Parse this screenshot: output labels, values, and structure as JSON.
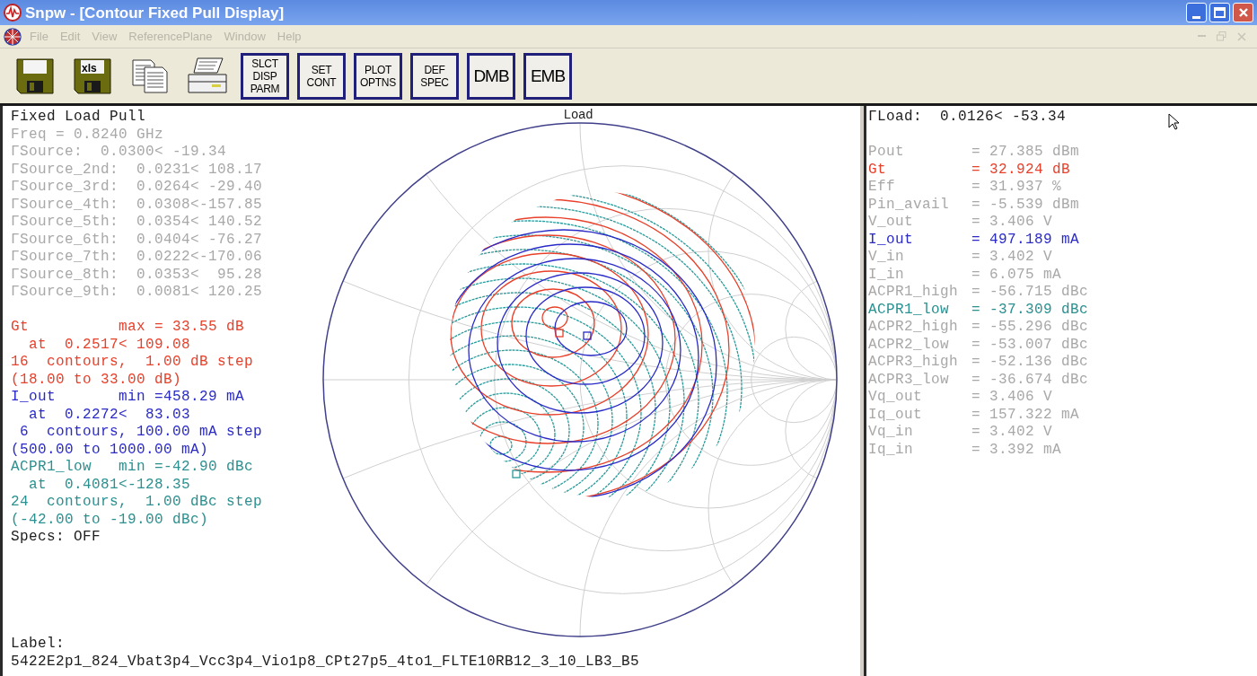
{
  "window": {
    "title": "Snpw - [Contour Fixed Pull Display]"
  },
  "menu": [
    {
      "label": "File",
      "disabled": true
    },
    {
      "label": "Edit",
      "disabled": true
    },
    {
      "label": "View",
      "disabled": true
    },
    {
      "label": "ReferencePlane",
      "disabled": true
    },
    {
      "label": "Window",
      "disabled": true
    },
    {
      "label": "Help",
      "disabled": true
    }
  ],
  "toolbar": [
    {
      "kind": "floppy"
    },
    {
      "kind": "floppy",
      "text": "xls"
    },
    {
      "kind": "copy"
    },
    {
      "kind": "printer"
    },
    {
      "kind": "text",
      "label": "SLCT\nDISP\nPARM"
    },
    {
      "kind": "text",
      "label": "SET\nCONT"
    },
    {
      "kind": "text",
      "label": "PLOT\nOPTNS"
    },
    {
      "kind": "text",
      "label": "DEF\nSPEC"
    },
    {
      "kind": "big",
      "label": "DMB"
    },
    {
      "kind": "big",
      "label": "EMB"
    }
  ],
  "left_panel": {
    "heading": "Fixed Load Pull",
    "source_lines": [
      {
        "text": "Freq = 0.8240 GHz",
        "color": "#a8a8a8"
      },
      {
        "text": "ΓSource:  0.0300< -19.34",
        "color": "#a8a8a8"
      },
      {
        "text": "ΓSource_2nd:  0.0231< 108.17",
        "color": "#a8a8a8"
      },
      {
        "text": "ΓSource_3rd:  0.0264< -29.40",
        "color": "#a8a8a8"
      },
      {
        "text": "ΓSource_4th:  0.0308<-157.85",
        "color": "#a8a8a8"
      },
      {
        "text": "ΓSource_5th:  0.0354< 140.52",
        "color": "#a8a8a8"
      },
      {
        "text": "ΓSource_6th:  0.0404< -76.27",
        "color": "#a8a8a8"
      },
      {
        "text": "ΓSource_7th:  0.0222<-170.06",
        "color": "#a8a8a8"
      },
      {
        "text": "ΓSource_8th:  0.0353<  95.28",
        "color": "#a8a8a8"
      },
      {
        "text": "ΓSource_9th:  0.0081< 120.25",
        "color": "#a8a8a8"
      }
    ],
    "contour_lines": [
      {
        "text": "Gt          max = 33.55 dB",
        "color": "#e8402a"
      },
      {
        "text": "  at  0.2517< 109.08",
        "color": "#e8402a"
      },
      {
        "text": "16  contours,  1.00 dB step",
        "color": "#e8402a"
      },
      {
        "text": "(18.00 to 33.00 dB)",
        "color": "#e8402a"
      },
      {
        "text": "I_out       min =458.29 mA",
        "color": "#2a2ac8"
      },
      {
        "text": "  at  0.2272<  83.03",
        "color": "#2a2ac8"
      },
      {
        "text": " 6  contours, 100.00 mA step",
        "color": "#2a2ac8"
      },
      {
        "text": "(500.00 to 1000.00 mA)",
        "color": "#2a2ac8"
      },
      {
        "text": "ACPR1_low   min =-42.90 dBc",
        "color": "#2a9090"
      },
      {
        "text": "  at  0.4081<-128.35",
        "color": "#2a9090"
      },
      {
        "text": "24  contours,  1.00 dBc step",
        "color": "#2a9090"
      },
      {
        "text": "(-42.00 to -19.00 dBc)",
        "color": "#2a9090"
      },
      {
        "text": "Specs: OFF",
        "color": "#202020"
      }
    ],
    "plot_title": "Load",
    "label_caption": "Label:",
    "label_value": "5422E2p1_824_Vbat3p4_Vcc3p4_Vio1p8_CPt27p5_4to1_FLTE10RB12_3_10_LB3_B5"
  },
  "right_panel": {
    "heading": "ΓLoad:  0.0126< -53.34",
    "readings": [
      {
        "name": "Pout",
        "value": "= 27.385 dBm",
        "color": "#a8a8a8"
      },
      {
        "name": "Gt",
        "value": "= 32.924 dB",
        "color": "#e8402a"
      },
      {
        "name": "Eff",
        "value": "= 31.937 %",
        "color": "#a8a8a8"
      },
      {
        "name": "Pin_avail",
        "value": "= -5.539 dBm",
        "color": "#a8a8a8"
      },
      {
        "name": "V_out",
        "value": "= 3.406 V",
        "color": "#a8a8a8"
      },
      {
        "name": "I_out",
        "value": "= 497.189 mA",
        "color": "#2a2ac8"
      },
      {
        "name": "V_in",
        "value": "= 3.402 V",
        "color": "#a8a8a8"
      },
      {
        "name": "I_in",
        "value": "= 6.075 mA",
        "color": "#a8a8a8"
      },
      {
        "name": "ACPR1_high",
        "value": "= -56.715 dBc",
        "color": "#a8a8a8"
      },
      {
        "name": "ACPR1_low",
        "value": "= -37.309 dBc",
        "color": "#2a9090"
      },
      {
        "name": "ACPR2_high",
        "value": "= -55.296 dBc",
        "color": "#a8a8a8"
      },
      {
        "name": "ACPR2_low",
        "value": "= -53.007 dBc",
        "color": "#a8a8a8"
      },
      {
        "name": "ACPR3_high",
        "value": "= -52.136 dBc",
        "color": "#a8a8a8"
      },
      {
        "name": "ACPR3_low",
        "value": "= -36.674 dBc",
        "color": "#a8a8a8"
      },
      {
        "name": "Vq_out",
        "value": "= 3.406 V",
        "color": "#a8a8a8"
      },
      {
        "name": "Iq_out",
        "value": "= 157.322 mA",
        "color": "#a8a8a8"
      },
      {
        "name": "Vq_in",
        "value": "= 3.402 V",
        "color": "#a8a8a8"
      },
      {
        "name": "Iq_in",
        "value": "= 3.392 mA",
        "color": "#a8a8a8"
      }
    ]
  }
}
